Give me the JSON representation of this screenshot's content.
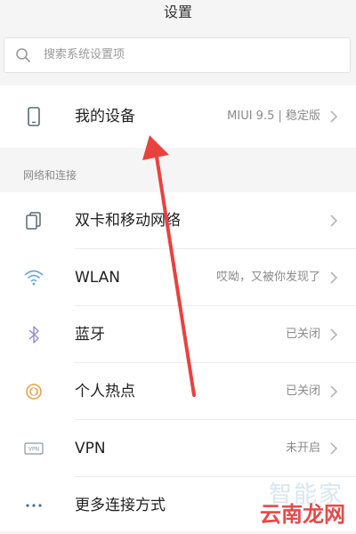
{
  "header": {
    "title": "设置"
  },
  "search": {
    "placeholder": "搜索系统设置项",
    "icon": "search-icon"
  },
  "device": {
    "label": "我的设备",
    "value": "MIUI 9.5 | 稳定版",
    "icon": "phone-icon"
  },
  "section": {
    "title": "网络和连接"
  },
  "network_items": [
    {
      "label": "双卡和移动网络",
      "value": "",
      "icon": "dual-sim-icon"
    },
    {
      "label": "WLAN",
      "value": "哎呦，又被你发现了",
      "icon": "wifi-icon"
    },
    {
      "label": "蓝牙",
      "value": "已关闭",
      "icon": "bluetooth-icon"
    },
    {
      "label": "个人热点",
      "value": "已关闭",
      "icon": "hotspot-icon"
    },
    {
      "label": "VPN",
      "value": "未开启",
      "icon": "vpn-icon"
    },
    {
      "label": "更多连接方式",
      "value": "",
      "icon": "more-icon"
    }
  ],
  "watermark": {
    "line1": "智能家",
    "line2": "云南龙网"
  },
  "colors": {
    "accent_arrow": "#e8423f",
    "background": "#f5f5f5",
    "card": "#ffffff"
  }
}
